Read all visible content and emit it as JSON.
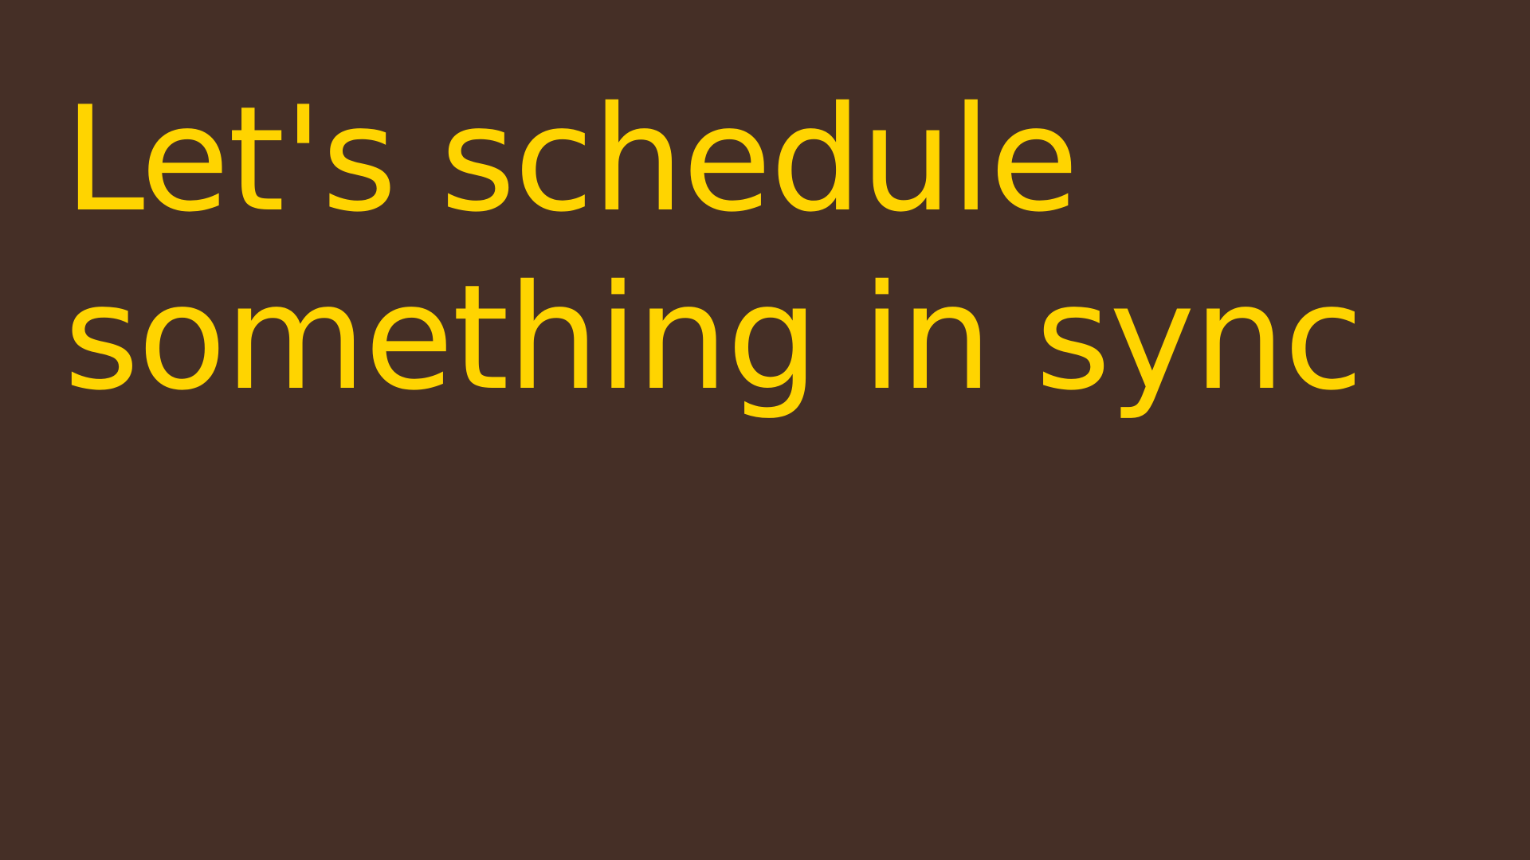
{
  "slide": {
    "title": "Let's schedule something in sync"
  },
  "colors": {
    "background": "#452f26",
    "title_text": "#ffd400"
  }
}
